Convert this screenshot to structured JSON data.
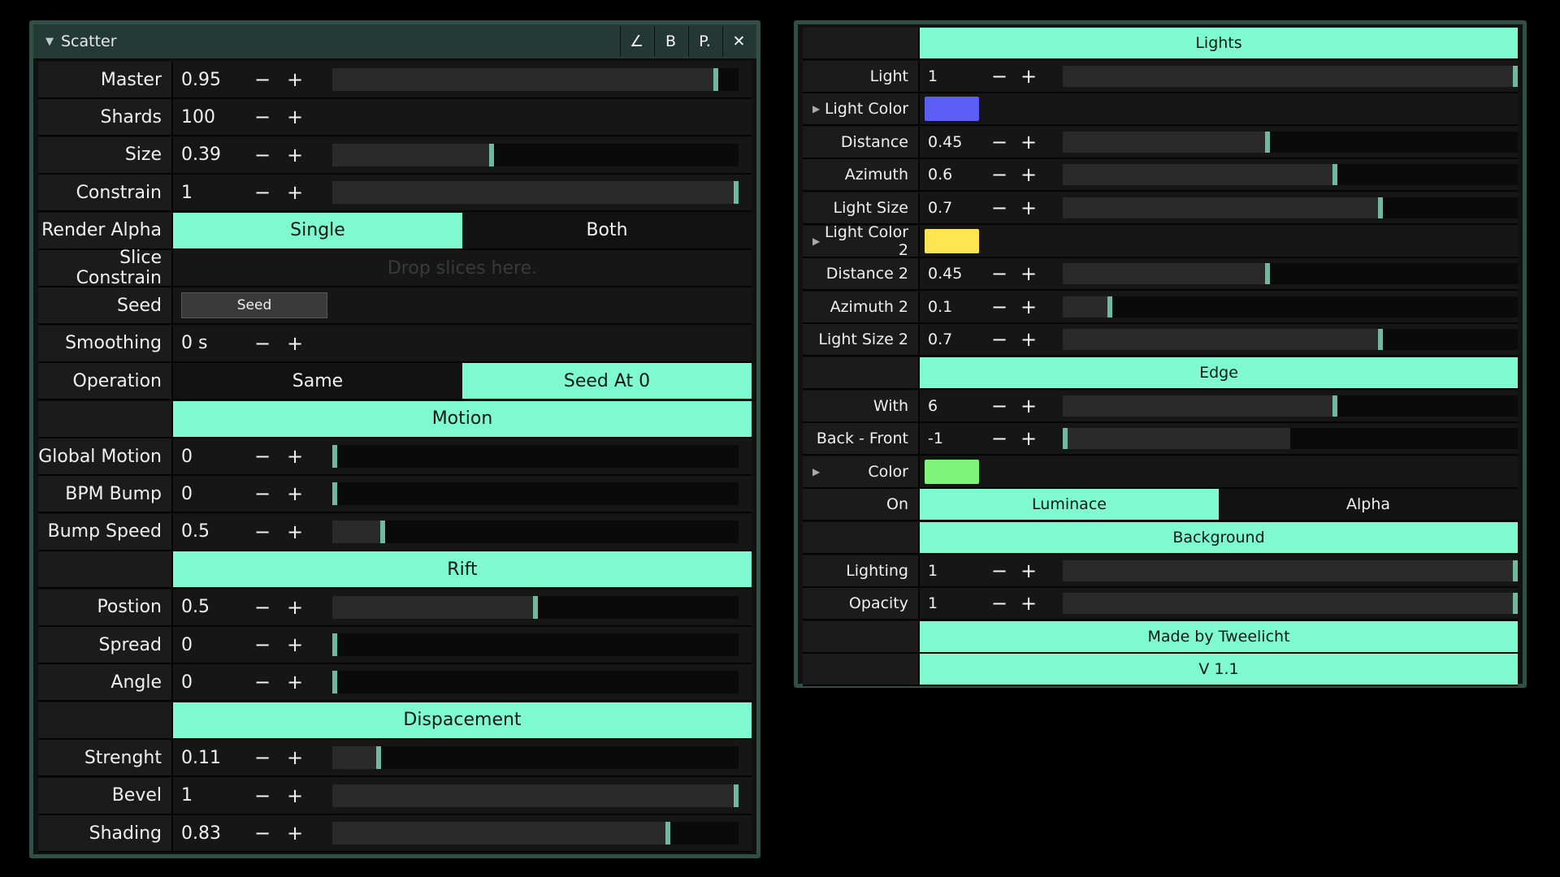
{
  "left_panel": {
    "title": "Scatter",
    "buttons": [
      "∠",
      "B",
      "P.",
      "✕"
    ],
    "rows": [
      {
        "type": "slider",
        "label": "Master",
        "value": "0.95",
        "level": 0.95
      },
      {
        "type": "number",
        "label": "Shards",
        "value": "100"
      },
      {
        "type": "slider",
        "label": "Size",
        "value": "0.39",
        "level": 0.39
      },
      {
        "type": "slider",
        "label": "Constrain",
        "value": "1",
        "level": 1.0
      },
      {
        "type": "segment",
        "label": "Render Alpha",
        "options": [
          "Single",
          "Both"
        ],
        "selected": 0
      },
      {
        "type": "drop",
        "label": "Slice Constrain",
        "placeholder": "Drop slices here."
      },
      {
        "type": "button",
        "label": "Seed",
        "button_label": "Seed"
      },
      {
        "type": "number",
        "label": "Smoothing",
        "value": "0 s"
      },
      {
        "type": "segment",
        "label": "Operation",
        "options": [
          "Same",
          "Seed At 0"
        ],
        "selected": 1
      },
      {
        "type": "header",
        "label": "Motion"
      },
      {
        "type": "slider",
        "label": "Global Motion",
        "value": "0",
        "level": 0.0
      },
      {
        "type": "slider",
        "label": "BPM Bump",
        "value": "0",
        "level": 0.0
      },
      {
        "type": "slider",
        "label": "Bump Speed",
        "value": "0.5",
        "level": 0.12
      },
      {
        "type": "header",
        "label": "Rift"
      },
      {
        "type": "slider",
        "label": "Postion",
        "value": "0.5",
        "level": 0.5
      },
      {
        "type": "slider",
        "label": "Spread",
        "value": "0",
        "level": 0.0
      },
      {
        "type": "slider",
        "label": "Angle",
        "value": "0",
        "level": 0.0
      },
      {
        "type": "header",
        "label": "Dispacement"
      },
      {
        "type": "slider",
        "label": "Strenght",
        "value": "0.11",
        "level": 0.11
      },
      {
        "type": "slider",
        "label": "Bevel",
        "value": "1",
        "level": 1.0
      },
      {
        "type": "slider",
        "label": "Shading",
        "value": "0.83",
        "level": 0.83
      }
    ]
  },
  "right_panel": {
    "rows": [
      {
        "type": "header",
        "label": "Lights"
      },
      {
        "type": "slider",
        "label": "Light",
        "value": "1",
        "level": 1.0
      },
      {
        "type": "color",
        "label": "Light Color",
        "color": "#5b5ef5"
      },
      {
        "type": "slider",
        "label": "Distance",
        "value": "0.45",
        "level": 0.45
      },
      {
        "type": "slider",
        "label": "Azimuth",
        "value": "0.6",
        "level": 0.6
      },
      {
        "type": "slider",
        "label": "Light Size",
        "value": "0.7",
        "level": 0.7
      },
      {
        "type": "color",
        "label": "Light Color 2",
        "color": "#ffe552"
      },
      {
        "type": "slider",
        "label": "Distance 2",
        "value": "0.45",
        "level": 0.45
      },
      {
        "type": "slider",
        "label": "Azimuth 2",
        "value": "0.1",
        "level": 0.1
      },
      {
        "type": "slider",
        "label": "Light Size 2",
        "value": "0.7",
        "level": 0.7
      },
      {
        "type": "header",
        "label": "Edge"
      },
      {
        "type": "slider",
        "label": "With",
        "value": "6",
        "level": 0.6
      },
      {
        "type": "slider",
        "label": "Back - Front",
        "value": "-1",
        "level": 0.0,
        "track_fill": 0.5
      },
      {
        "type": "color",
        "label": "Color",
        "color": "#7ff47a"
      },
      {
        "type": "segment",
        "label": "On",
        "options": [
          "Luminace",
          "Alpha"
        ],
        "selected": 0
      },
      {
        "type": "header",
        "label": "Background"
      },
      {
        "type": "slider",
        "label": "Lighting",
        "value": "1",
        "level": 1.0
      },
      {
        "type": "slider",
        "label": "Opacity",
        "value": "1",
        "level": 1.0
      },
      {
        "type": "header",
        "label": "Made by Tweelicht"
      },
      {
        "type": "header",
        "label": "V 1.1"
      }
    ]
  },
  "colors": {
    "accent": "#7ff9cf",
    "handle": "#6fb9a0",
    "panel_border": "#2f4f47"
  },
  "pm_labels": {
    "minus": "−",
    "plus": "+"
  }
}
